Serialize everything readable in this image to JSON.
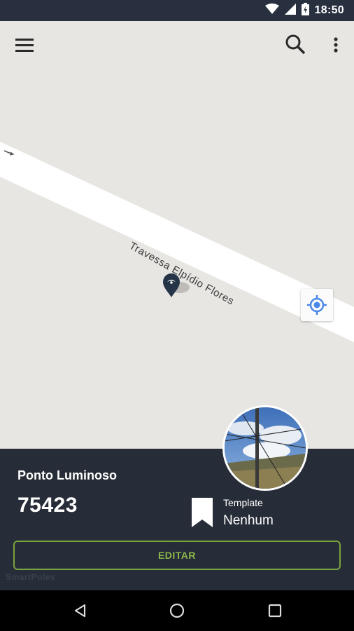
{
  "status_bar": {
    "time": "18:50",
    "icons": [
      "wifi-icon",
      "signal-icon",
      "battery-icon"
    ]
  },
  "app_bar": {
    "icons": [
      "menu-icon",
      "search-icon",
      "more-vert-icon"
    ]
  },
  "map": {
    "street_name": "Travessa Elpídio Flores"
  },
  "panel": {
    "title": "Ponto Luminoso",
    "number": "75423",
    "template_label": "Template",
    "template_value": "Nenhum",
    "edit_label": "EDITAR",
    "watermark": "SmartPoles"
  },
  "nav_bar": {
    "icons": [
      "back-icon",
      "home-icon",
      "recents-icon"
    ]
  },
  "colors": {
    "status_bar": "#283040",
    "panel": "#272d38",
    "accent_green": "#8bb64b",
    "map_bg": "#e8e6e2",
    "locate_blue": "#4a87e8"
  }
}
